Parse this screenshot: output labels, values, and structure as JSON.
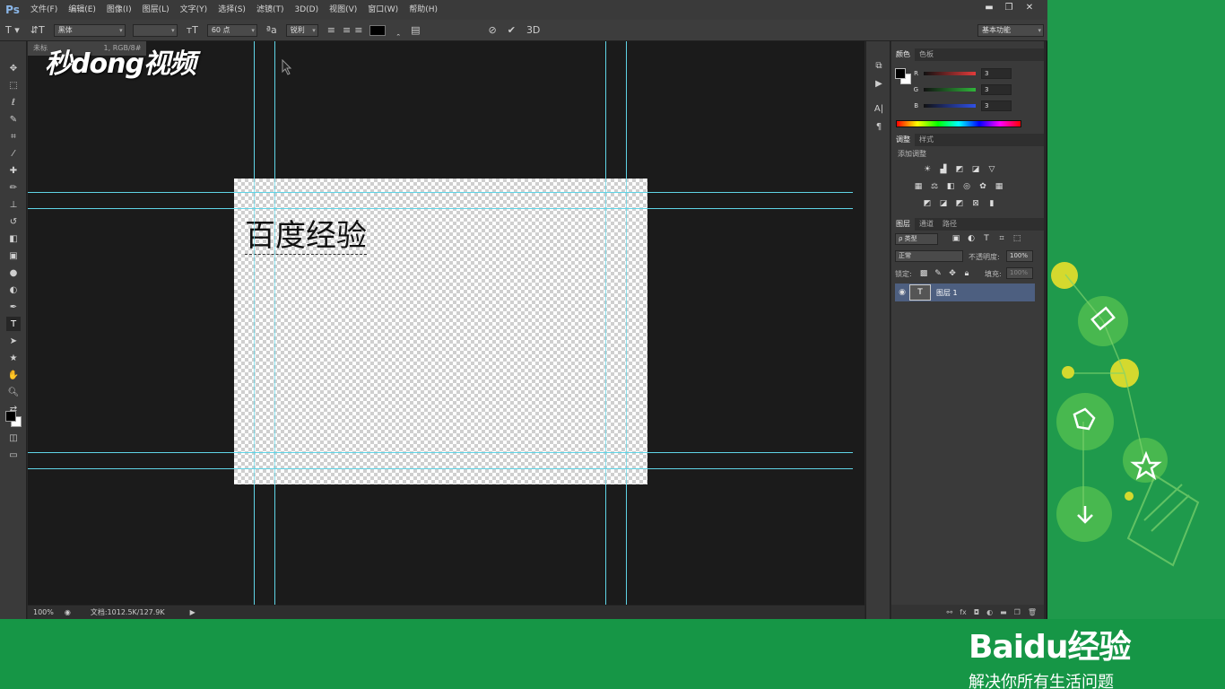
{
  "app": {
    "logo": "Ps"
  },
  "menu": [
    "文件(F)",
    "编辑(E)",
    "图像(I)",
    "图层(L)",
    "文字(Y)",
    "选择(S)",
    "滤镜(T)",
    "3D(D)",
    "视图(V)",
    "窗口(W)",
    "帮助(H)"
  ],
  "window_controls": {
    "minimize": "▬",
    "restore": "❐",
    "close": "✕"
  },
  "options": {
    "font_family": "黑体",
    "font_size": "60 点",
    "antialias": "锐利",
    "workspace": "基本功能",
    "three_d": "3D",
    "text_color": "#000000"
  },
  "document": {
    "tab_label": "未标",
    "tab_suffix": "1, RGB/8#",
    "canvas_text": "百度经验",
    "watermark": "秒dong视频"
  },
  "status": {
    "zoom": "100%",
    "doc_info": "文档:1012.5K/127.9K"
  },
  "panels": {
    "color": {
      "tabs": [
        "颜色",
        "色板"
      ],
      "channels": [
        {
          "label": "R",
          "value": "3",
          "color": "#e23b3b"
        },
        {
          "label": "G",
          "value": "3",
          "color": "#2fb53a"
        },
        {
          "label": "B",
          "value": "3",
          "color": "#2f50e6"
        }
      ]
    },
    "adjustments": {
      "tabs": [
        "调整",
        "样式"
      ],
      "subtitle": "添加调整"
    },
    "layers": {
      "tabs": [
        "图层",
        "通道",
        "路径"
      ],
      "filter_label": "ρ 类型",
      "blend_mode": "正常",
      "opacity_label": "不透明度:",
      "opacity_value": "100%",
      "lock_label": "锁定:",
      "fill_label": "填充:",
      "fill_value": "100%",
      "layer_name": "图层 1"
    }
  },
  "branding": {
    "baidu_logo": "Baidu经验",
    "slogan": "解决你所有生活问题"
  }
}
